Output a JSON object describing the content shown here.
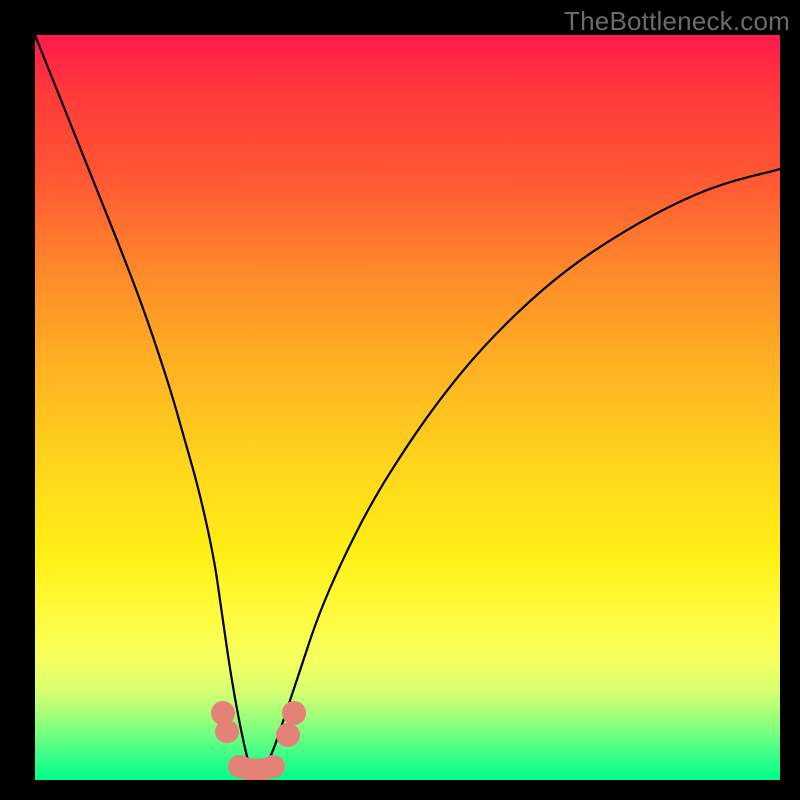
{
  "attribution": "TheBottleneck.com",
  "colors": {
    "curve": "#000000",
    "dot": "#e48278",
    "frame": "#000000"
  },
  "chart_data": {
    "type": "line",
    "title": "",
    "xlabel": "",
    "ylabel": "",
    "xlim": [
      0,
      100
    ],
    "ylim": [
      0,
      100
    ],
    "note": "x is horizontal position as % of plot width (left=0), y is vertical fill as % of plot height (bottom=0). Curve is a V-shaped bottleneck profile; minimum sits near x≈29 at y≈0 (green band).",
    "series": [
      {
        "name": "bottleneck-curve",
        "x": [
          0,
          4,
          8,
          12,
          15,
          18,
          20,
          22,
          24,
          25,
          26,
          27,
          28,
          29,
          30,
          31,
          32,
          33,
          34,
          36,
          38,
          41,
          45,
          50,
          55,
          60,
          66,
          72,
          78,
          85,
          92,
          100
        ],
        "y": [
          100,
          90,
          80,
          70,
          62,
          53,
          46,
          39,
          30,
          23,
          16,
          10,
          5,
          1,
          1,
          2,
          4,
          7,
          10,
          16,
          22,
          29,
          37,
          45,
          52,
          58,
          64,
          69,
          73,
          77,
          80,
          82
        ]
      }
    ],
    "markers": [
      {
        "name": "left-cluster-upper",
        "x": 25.2,
        "y": 9.0,
        "r": 1.6
      },
      {
        "name": "left-cluster-lower",
        "x": 25.8,
        "y": 6.5,
        "r": 1.6
      },
      {
        "name": "trough-1",
        "x": 27.5,
        "y": 1.8,
        "r": 1.6
      },
      {
        "name": "trough-2",
        "x": 29.0,
        "y": 1.3,
        "r": 1.6
      },
      {
        "name": "trough-3",
        "x": 30.5,
        "y": 1.3,
        "r": 1.6
      },
      {
        "name": "trough-4",
        "x": 32.0,
        "y": 1.8,
        "r": 1.6
      },
      {
        "name": "right-cluster-lower",
        "x": 34.0,
        "y": 6.0,
        "r": 1.6
      },
      {
        "name": "right-cluster-upper",
        "x": 34.8,
        "y": 9.0,
        "r": 1.6
      }
    ]
  }
}
